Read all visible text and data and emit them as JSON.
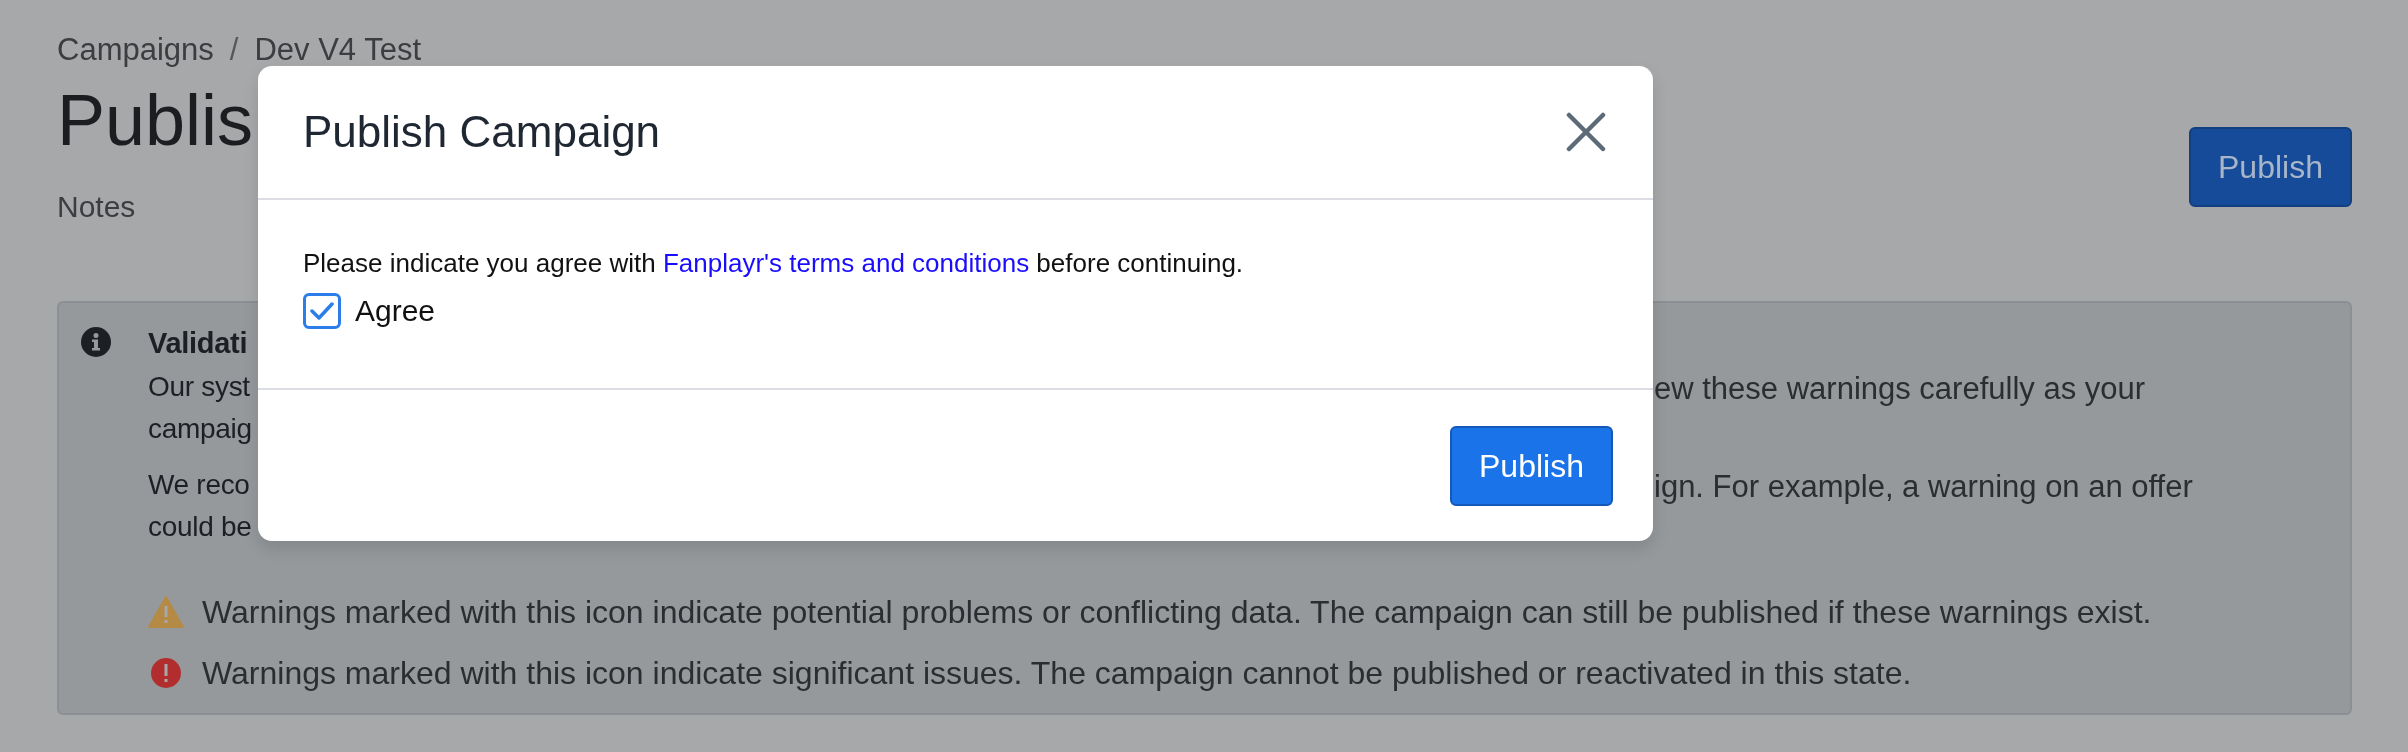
{
  "breadcrumb": {
    "items": [
      "Campaigns",
      "Dev V4 Test"
    ],
    "separator": "/"
  },
  "page": {
    "title": "Publis",
    "subtitle": "Notes",
    "publish_button": "Publish"
  },
  "alert": {
    "title": "Validati",
    "paragraphs": [
      [
        {
          "left": "Our syst",
          "right": "ew these warnings carefully as your"
        },
        {
          "left": "campaig"
        }
      ],
      [
        {
          "left": "We reco",
          "right": "ign. For example, a warning on an offer"
        },
        {
          "left": "could be"
        }
      ]
    ],
    "warnings": [
      {
        "kind": "warning",
        "text": "Warnings marked with this icon indicate potential problems or conflicting data. The campaign can still be published if these warnings exist."
      },
      {
        "kind": "error",
        "text": "Warnings marked with this icon indicate significant issues. The campaign cannot be published or reactivated in this state."
      }
    ]
  },
  "modal": {
    "title": "Publish Campaign",
    "body": {
      "before": "Please indicate you agree with ",
      "link": "Fanplayr's terms and conditions",
      "after": " before continuing."
    },
    "checkbox": {
      "label": "Agree",
      "checked": true
    },
    "button": "Publish"
  }
}
